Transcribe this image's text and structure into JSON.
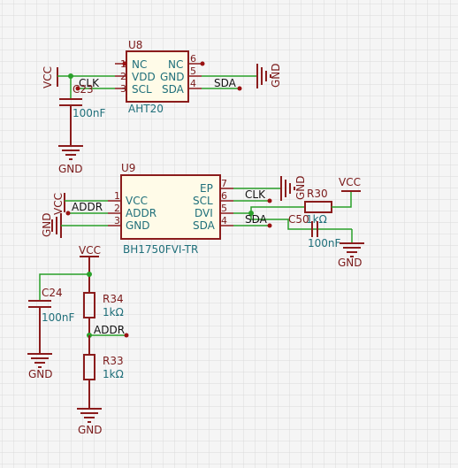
{
  "colors": {
    "background": "#f5f5f5",
    "grid": "#dadada",
    "component": "#8b1c1c",
    "wire": "#2aa02a",
    "teal_text": "#1f6f7a",
    "net_text": "#111111"
  },
  "u8": {
    "ref": "U8",
    "value": "AHT20",
    "pins_left": [
      {
        "num": "1",
        "name": "NC"
      },
      {
        "num": "2",
        "name": "VDD"
      },
      {
        "num": "3",
        "name": "SCL"
      }
    ],
    "pins_right": [
      {
        "num": "6",
        "name": "NC"
      },
      {
        "num": "5",
        "name": "GND"
      },
      {
        "num": "4",
        "name": "SDA"
      }
    ]
  },
  "u9": {
    "ref": "U9",
    "value": "BH1750FVI-TR",
    "pins_left": [
      {
        "num": "1",
        "name": "VCC"
      },
      {
        "num": "2",
        "name": "ADDR"
      },
      {
        "num": "3",
        "name": "GND"
      }
    ],
    "pins_right": [
      {
        "num": "7",
        "name": "EP"
      },
      {
        "num": "6",
        "name": "SCL"
      },
      {
        "num": "5",
        "name": "DVI"
      },
      {
        "num": "4",
        "name": "SDA"
      }
    ]
  },
  "c23": {
    "ref": "C23",
    "value": "100nF"
  },
  "c24": {
    "ref": "C24",
    "value": "100nF"
  },
  "c50": {
    "ref": "C50",
    "value": "100nF"
  },
  "r30": {
    "ref": "R30",
    "value": "1kΩ"
  },
  "r33": {
    "ref": "R33",
    "value": "1kΩ"
  },
  "r34": {
    "ref": "R34",
    "value": "1kΩ"
  },
  "nets": {
    "vcc": "VCC",
    "gnd": "GND",
    "clk": "CLK",
    "sda": "SDA",
    "addr": "ADDR"
  }
}
